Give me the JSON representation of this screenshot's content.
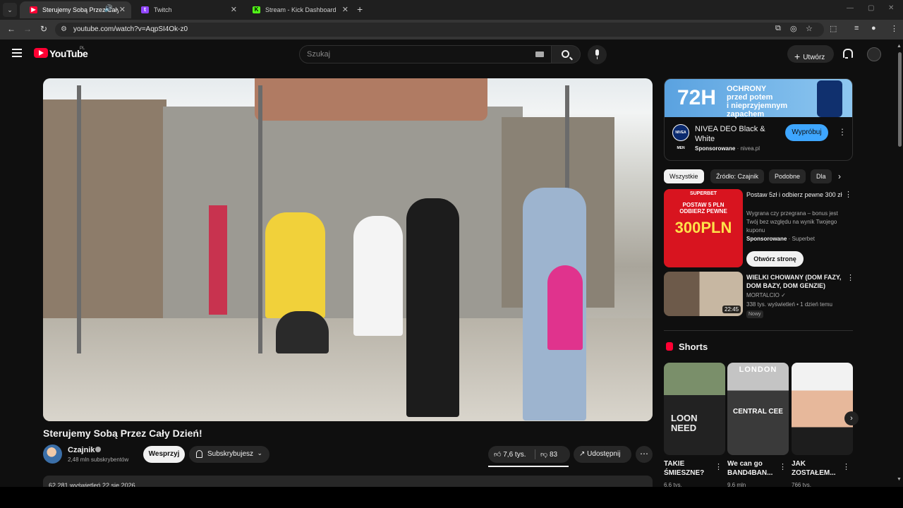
{
  "browser": {
    "tabs": [
      {
        "label": "Sterujemy Sobą Przez Cały D",
        "favicon": "youtube-icon",
        "active": true
      },
      {
        "label": "Twitch",
        "favicon": "twitch-icon",
        "active": false
      },
      {
        "label": "Stream - Kick Dashboard",
        "favicon": "kick-icon",
        "active": false
      }
    ],
    "new_tab": "+",
    "url": "youtube.com/watch?v=AqpSI4Ok-z0"
  },
  "header": {
    "wordmark": "YouTube",
    "country": "PL",
    "search_placeholder": "Szukaj",
    "create_label": "Utwórz"
  },
  "video": {
    "title": "Sterujemy Sobą Przez Cały Dzień!",
    "channel": "Czajnik",
    "subscribers": "2,48 mln subskrybentów",
    "support_label": "Wesprzyj",
    "subscribed_label": "Subskrybujesz",
    "likes": "7,6 tys.",
    "dislikes": "83",
    "share_label": "Udostępnij",
    "description_stats": "62 281 wyświetleń  22 sie 2026"
  },
  "ad": {
    "banner_big": "72H",
    "banner_text": [
      "OCHRONY",
      "przed potem",
      "i nieprzyjemnym",
      "zapachem"
    ],
    "logo_text": "NIVEA MEN",
    "title": "NIVEA DEO Black & White",
    "sponsored": "Sponsorowane",
    "domain": "nivea.pl",
    "cta": "Wypróbuj"
  },
  "chips": [
    "Wszystkie",
    "Źródło: Czajnik",
    "Podobne",
    "Dla"
  ],
  "sidebar_items": [
    {
      "title": "Postaw 5zł i odbierz pewne 300 zł",
      "desc": "Wygrana czy przegrana – bonus jest Twój bez względu na wynik Twojego kuponu",
      "sponsored": "Sponsorowane",
      "advertiser": "Superbet",
      "thumb_top": "SUPERBET",
      "thumb_mid": "POSTAW 5 PLN ODBIERZ PEWNE",
      "thumb_big": "300PLN",
      "cta": "Otwórz stronę"
    },
    {
      "title": "WIELKI CHOWANY (DOM FAZY, DOM BAZY, DOM GENZIE)",
      "channel": "MORTALCIO",
      "meta": "338 tys. wyświetleń • 1 dzień temu",
      "badge": "Nowy",
      "duration": "22:45"
    }
  ],
  "shorts": {
    "heading": "Shorts",
    "items": [
      {
        "title": "TAKIE ŚMIESZNE?",
        "meta": "6,6 tys.",
        "overlay": "LOON NEED"
      },
      {
        "title": "We can go BAND4BAN...",
        "meta": "9,6 mln",
        "overlay_top": "LONDON",
        "overlay_mid": "CENTRAL CEE"
      },
      {
        "title": "JAK ZOSTAŁEM...",
        "meta": "766 tys."
      }
    ]
  },
  "colors": {
    "background": "#0f0f0f",
    "brand_red": "#ff0033",
    "accent_blue": "#3ea6ff"
  }
}
